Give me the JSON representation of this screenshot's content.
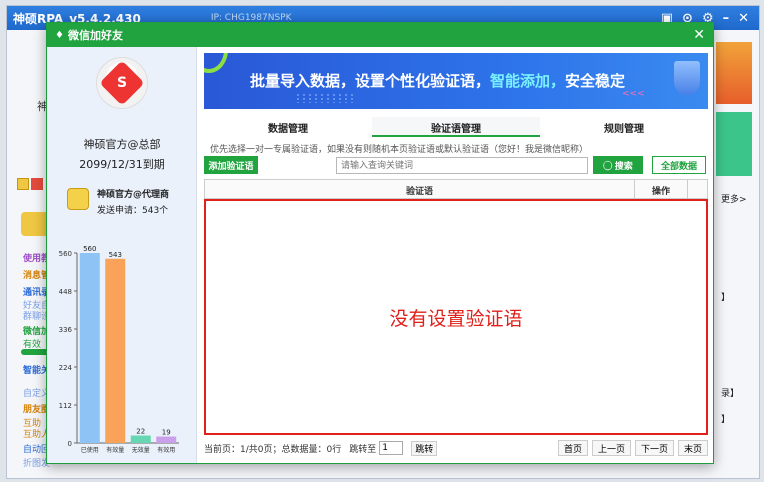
{
  "bg_app": {
    "title": "神硕RPA_v5.4.2.430",
    "ip": "IP: CHG1987NSPK",
    "controls": [
      "▣",
      "⊙",
      "⚙",
      "–",
      "✕"
    ],
    "left_labels": [
      "神",
      "使用教",
      "消息管",
      "通讯录",
      "好友自",
      "群聊设",
      "微信加",
      "有效",
      "智能关",
      "自定义",
      "朋友圈",
      "互助",
      "互助人",
      "自动回",
      "折图发"
    ],
    "right_labels": [
      "更多>",
      "】",
      "录】",
      "】",
      "】"
    ]
  },
  "dialog": {
    "title": "微信加好友",
    "close": "✕"
  },
  "account": {
    "name": "神硕官方@总部",
    "expire": "2099/12/31到期",
    "agent_name": "神硕官方@代理商",
    "agent_count": "发送申请：543个"
  },
  "chart_data": {
    "type": "bar",
    "categories": [
      "已使用",
      "有效量",
      "无效量",
      "有效用"
    ],
    "values": [
      560,
      543,
      22,
      19
    ],
    "colors": [
      "#8ec3f5",
      "#f8a25a",
      "#67d6b2",
      "#caa0ea"
    ],
    "yticks": [
      0,
      112,
      224,
      336,
      448,
      560
    ],
    "ylim": [
      0,
      560
    ]
  },
  "banner": {
    "text_before": "批量导入数据，设置个性化验证语，",
    "text_highlight": "智能添加，",
    "text_after": "安全稳定",
    "chevrons": "<<<"
  },
  "tabs": [
    "数据管理",
    "验证语管理",
    "规则管理"
  ],
  "hint": "优先选择一对一专属验证语，如果没有则随机本页验证语或默认验证语（您好！我是微信昵称）",
  "toolbar": {
    "add_label": "添加验证语",
    "search_placeholder": "请输入查询关键词",
    "search_label": "◯ 搜索",
    "all_label": "全部数据"
  },
  "table": {
    "col_verify": "验证语",
    "col_action": "操作",
    "empty": "没有设置验证语"
  },
  "pager": {
    "info": "当前页：1/共0页；总数据量：0行",
    "jump_label": "跳转至",
    "jump_value": "1",
    "jump_btn": "跳转",
    "first": "首页",
    "prev": "上一页",
    "next": "下一页",
    "last": "末页"
  }
}
